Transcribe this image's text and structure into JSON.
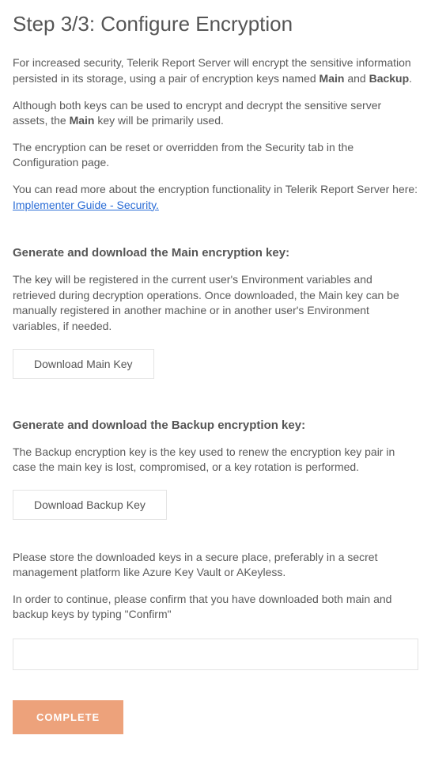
{
  "title": "Step 3/3: Configure Encryption",
  "intro": {
    "p1_a": "For increased security, Telerik Report Server will encrypt the sensitive information persisted in its storage, using a pair of encryption keys named ",
    "p1_b_main": "Main",
    "p1_c": " and ",
    "p1_d_backup": "Backup",
    "p1_e": ".",
    "p2_a": "Although both keys can be used to encrypt and decrypt the sensitive server assets, the ",
    "p2_b_main": "Main",
    "p2_c": " key will be primarily used.",
    "p3": "The encryption can be reset or overridden from the Security tab in the Configuration page.",
    "p4_a": "You can read more about the encryption functionality in Telerik Report Server here: ",
    "p4_link": "Implementer Guide - Security."
  },
  "main_key": {
    "heading": "Generate and download the Main encryption key:",
    "desc": "The key will be registered in the current user's Environment variables and retrieved during decryption operations. Once downloaded, the Main key can be manually registered in another machine or in another user's Environment variables, if needed.",
    "button": "Download Main Key"
  },
  "backup_key": {
    "heading": "Generate and download the Backup encryption key:",
    "desc": "The Backup encryption key is the key used to renew the encryption key pair in case the main key is lost, compromised, or a key rotation is performed.",
    "button": "Download Backup Key"
  },
  "store_note": "Please store the downloaded keys in a secure place, preferably in a secret management platform like Azure Key Vault or AKeyless.",
  "confirm_note": "In order to continue, please confirm that you have downloaded both main and backup keys by typing \"Confirm\"",
  "confirm_input_value": "",
  "complete_button": "COMPLETE"
}
